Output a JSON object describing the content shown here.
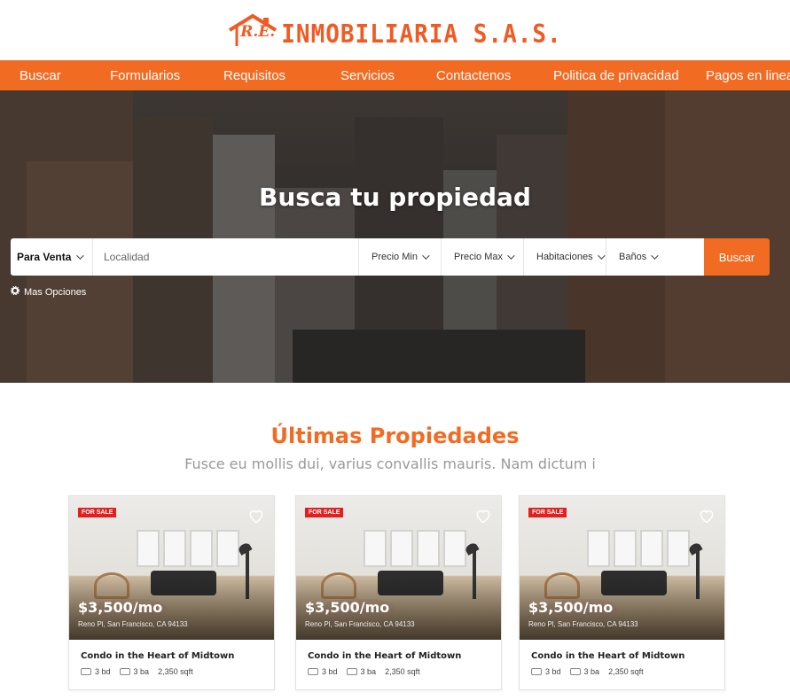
{
  "brand": {
    "initials": "R.E.",
    "name": "INMOBILIARIA S.A.S.",
    "accent": "#f26b22"
  },
  "nav": {
    "items": [
      {
        "label": "Buscar"
      },
      {
        "label": "Formularios"
      },
      {
        "label": "Requisitos"
      },
      {
        "label": "Servicios"
      },
      {
        "label": "Contactenos"
      },
      {
        "label": "Politica de privacidad"
      },
      {
        "label": "Pagos en linea"
      }
    ]
  },
  "hero": {
    "title": "Busca tu propiedad",
    "search": {
      "type_value": "Para Venta",
      "location_placeholder": "Localidad",
      "price_min": "Precio Min",
      "price_max": "Precio Max",
      "rooms": "Habitaciones",
      "baths": "Baños",
      "button": "Buscar",
      "more_options": "Mas Opciones"
    }
  },
  "latest": {
    "title": "Últimas Propiedades",
    "subtitle": "Fusce eu mollis dui, varius convallis mauris. Nam dictum i",
    "cards": [
      {
        "badge": "FOR SALE",
        "price": "$3,500/mo",
        "address": "Reno Pl, San Francisco, CA 94133",
        "title": "Condo in the Heart of Midtown",
        "beds": "3 bd",
        "baths": "3 ba",
        "area": "2,350 sqft"
      },
      {
        "badge": "FOR SALE",
        "price": "$3,500/mo",
        "address": "Reno Pl, San Francisco, CA 94133",
        "title": "Condo in the Heart of Midtown",
        "beds": "3 bd",
        "baths": "3 ba",
        "area": "2,350 sqft"
      },
      {
        "badge": "FOR SALE",
        "price": "$3,500/mo",
        "address": "Reno Pl, San Francisco, CA 94133",
        "title": "Condo in the Heart of Midtown",
        "beds": "3 bd",
        "baths": "3 ba",
        "area": "2,350 sqft"
      }
    ]
  }
}
